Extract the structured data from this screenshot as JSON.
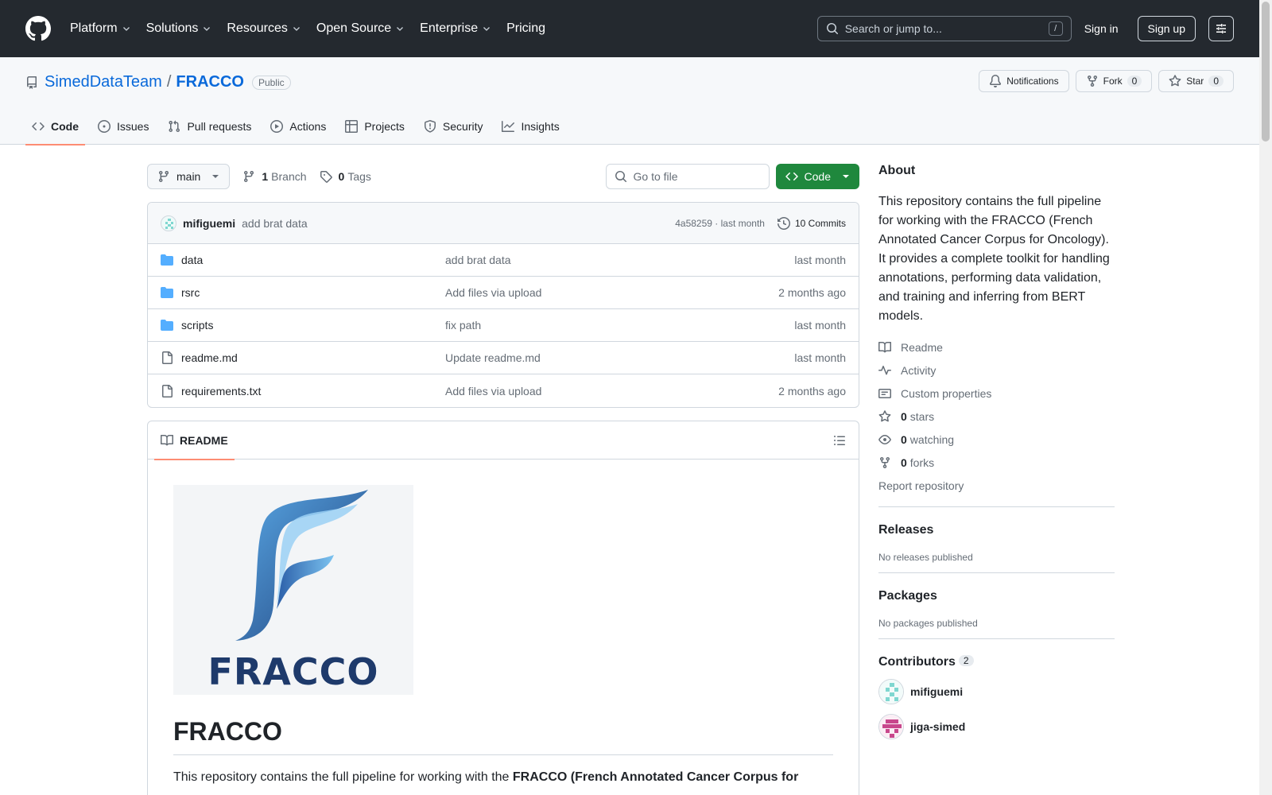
{
  "header": {
    "nav": [
      {
        "label": "Platform",
        "chevron": true
      },
      {
        "label": "Solutions",
        "chevron": true
      },
      {
        "label": "Resources",
        "chevron": true
      },
      {
        "label": "Open Source",
        "chevron": true
      },
      {
        "label": "Enterprise",
        "chevron": true
      },
      {
        "label": "Pricing",
        "chevron": false
      }
    ],
    "search_placeholder": "Search or jump to...",
    "search_shortcut": "/",
    "sign_in": "Sign in",
    "sign_up": "Sign up"
  },
  "repo": {
    "owner": "SimedDataTeam",
    "separator": "/",
    "name": "FRACCO",
    "visibility": "Public",
    "notifications_label": "Notifications",
    "fork_label": "Fork",
    "fork_count": "0",
    "star_label": "Star",
    "star_count": "0",
    "tabs": [
      {
        "label": "Code",
        "icon": "code-icon"
      },
      {
        "label": "Issues",
        "icon": "issue-icon"
      },
      {
        "label": "Pull requests",
        "icon": "pull-request-icon"
      },
      {
        "label": "Actions",
        "icon": "play-icon"
      },
      {
        "label": "Projects",
        "icon": "table-icon"
      },
      {
        "label": "Security",
        "icon": "shield-icon"
      },
      {
        "label": "Insights",
        "icon": "graph-icon"
      }
    ]
  },
  "toolbar": {
    "branch": "main",
    "branch_count": "1",
    "branch_label": "Branch",
    "tag_count": "0",
    "tag_label": "Tags",
    "goto_placeholder": "Go to file",
    "code_button": "Code"
  },
  "latest_commit": {
    "author": "mifiguemi",
    "message": "add brat data",
    "hash_time": "4a58259 · last month",
    "commits_label": "10 Commits"
  },
  "files": [
    {
      "name": "data",
      "type": "folder",
      "message": "add brat data",
      "date": "last month"
    },
    {
      "name": "rsrc",
      "type": "folder",
      "message": "Add files via upload",
      "date": "2 months ago"
    },
    {
      "name": "scripts",
      "type": "folder",
      "message": "fix path",
      "date": "last month"
    },
    {
      "name": "readme.md",
      "type": "file",
      "message": "Update readme.md",
      "date": "last month"
    },
    {
      "name": "requirements.txt",
      "type": "file",
      "message": "Add files via upload",
      "date": "2 months ago"
    }
  ],
  "readme": {
    "tab_label": "README",
    "logo_text": "FRACCO",
    "title": "FRACCO",
    "intro_text": "This repository contains the full pipeline for working with the ",
    "intro_bold": "FRACCO (French Annotated Cancer Corpus for"
  },
  "sidebar": {
    "about_title": "About",
    "about_desc": "This repository contains the full pipeline for working with the FRACCO (French Annotated Cancer Corpus for Oncology). It provides a complete toolkit for handling annotations, performing data validation, and training and inferring from BERT models.",
    "links": [
      {
        "icon": "book-icon",
        "bold": "",
        "label": "Readme"
      },
      {
        "icon": "pulse-icon",
        "bold": "",
        "label": "Activity"
      },
      {
        "icon": "note-icon",
        "bold": "",
        "label": "Custom properties"
      },
      {
        "icon": "star-icon",
        "bold": "0",
        "label": "stars"
      },
      {
        "icon": "eye-icon",
        "bold": "0",
        "label": "watching"
      },
      {
        "icon": "fork-icon",
        "bold": "0",
        "label": "forks"
      }
    ],
    "report": "Report repository",
    "releases_title": "Releases",
    "releases_text": "No releases published",
    "packages_title": "Packages",
    "packages_text": "No packages published",
    "contributors_title": "Contributors",
    "contributors_count": "2",
    "contributors": [
      {
        "name": "mifiguemi"
      },
      {
        "name": "jiga-simed"
      }
    ]
  },
  "colors": {
    "header_bg": "#24292f",
    "link": "#0969da",
    "primary_button": "#1f883d",
    "active_tab_underline": "#fd8c73",
    "folder": "#54aeff"
  }
}
